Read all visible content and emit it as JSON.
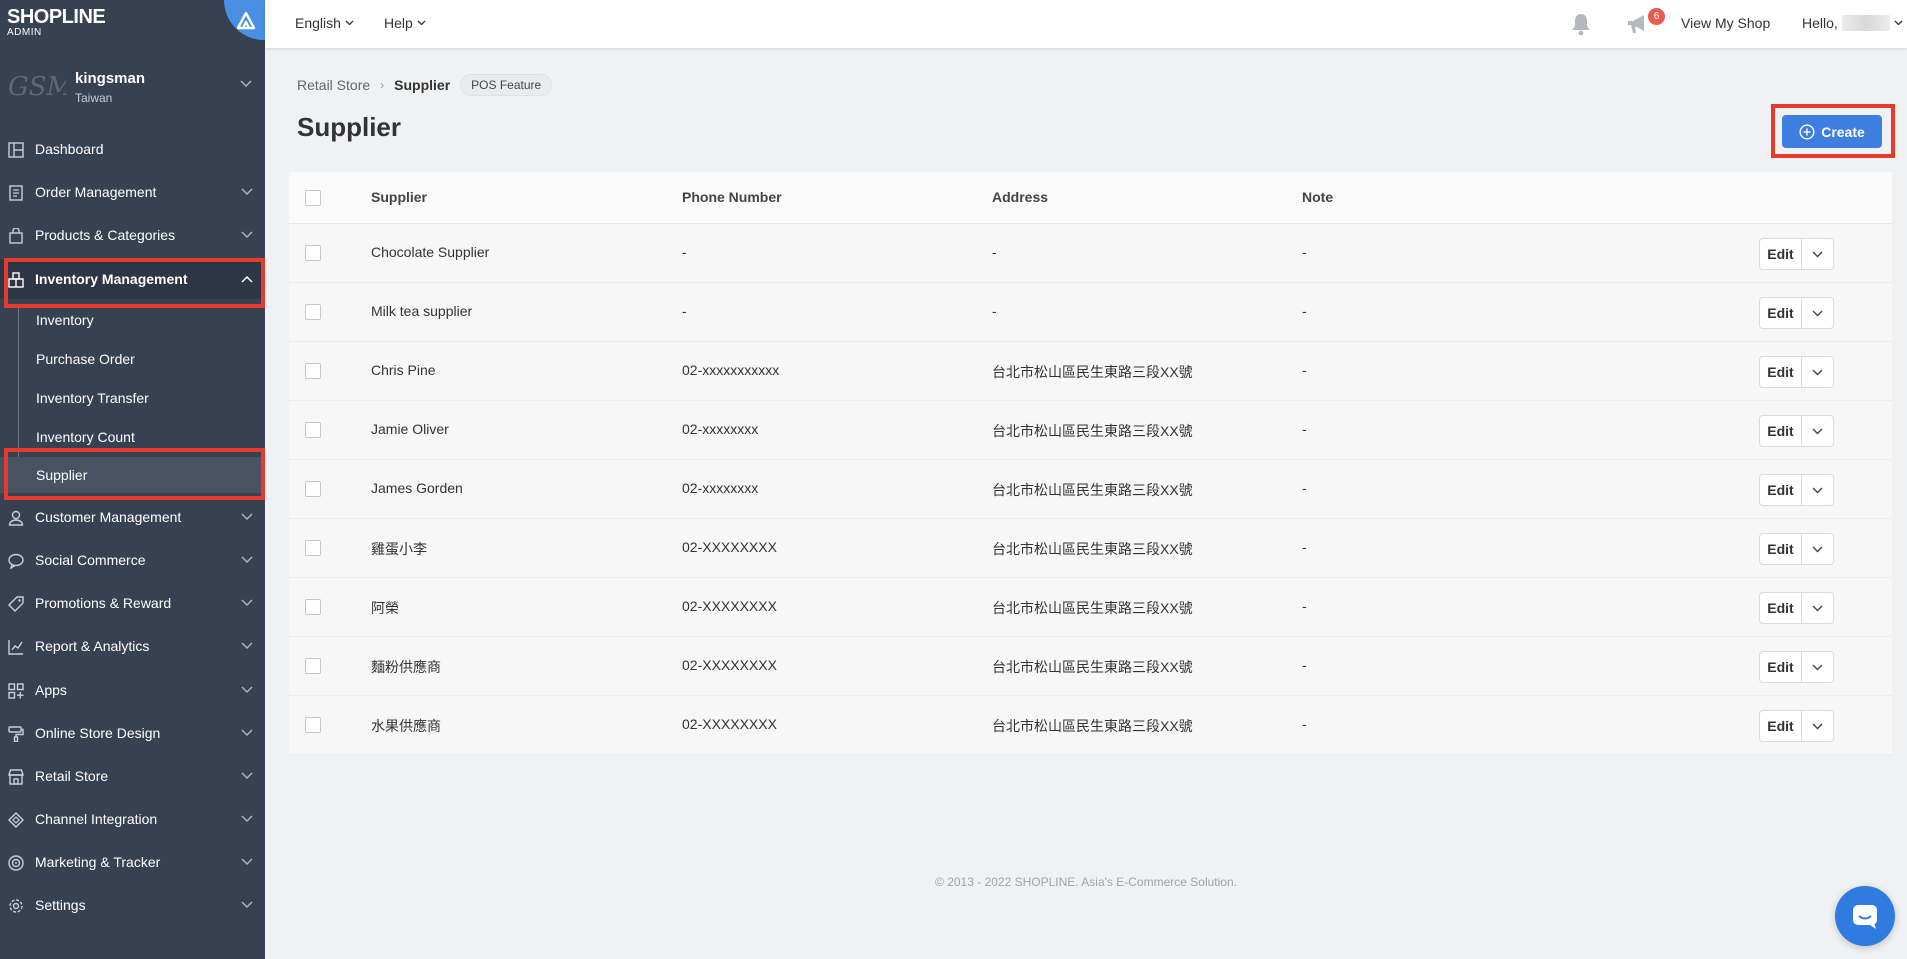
{
  "brand": {
    "logo": "SHOPLINE",
    "sub": "ADMIN",
    "accent": "#4a90e2"
  },
  "account": {
    "logo": "GSM",
    "name": "kingsman",
    "region": "Taiwan"
  },
  "sidebar": {
    "items": [
      {
        "label": "Dashboard",
        "icon": "dashboard-icon"
      },
      {
        "label": "Order Management",
        "icon": "order-icon"
      },
      {
        "label": "Products & Categories",
        "icon": "bag-icon"
      },
      {
        "label": "Inventory Management",
        "icon": "warehouse-icon"
      },
      {
        "label": "Customer Management",
        "icon": "user-icon"
      },
      {
        "label": "Social Commerce",
        "icon": "chat-icon"
      },
      {
        "label": "Promotions & Reward",
        "icon": "tag-icon"
      },
      {
        "label": "Report & Analytics",
        "icon": "chart-icon"
      },
      {
        "label": "Apps",
        "icon": "apps-icon"
      },
      {
        "label": "Online Store Design",
        "icon": "paint-icon"
      },
      {
        "label": "Retail Store",
        "icon": "store-icon"
      },
      {
        "label": "Channel Integration",
        "icon": "channel-icon"
      },
      {
        "label": "Marketing & Tracker",
        "icon": "target-icon"
      },
      {
        "label": "Settings",
        "icon": "gear-icon"
      }
    ],
    "sub_items": [
      "Inventory",
      "Purchase Order",
      "Inventory Transfer",
      "Inventory Count",
      "Supplier"
    ]
  },
  "header": {
    "language": "English",
    "help": "Help",
    "notification_count": "6",
    "view_shop": "View My Shop",
    "hello": "Hello,"
  },
  "breadcrumb": {
    "root": "Retail Store",
    "current": "Supplier",
    "tag": "POS Feature"
  },
  "page": {
    "title": "Supplier",
    "create_label": "Create"
  },
  "table": {
    "columns": [
      "Supplier",
      "Phone Number",
      "Address",
      "Note"
    ],
    "rows": [
      {
        "supplier": "Chocolate Supplier",
        "phone": "-",
        "address": "-",
        "note": "-"
      },
      {
        "supplier": "Milk tea supplier",
        "phone": "-",
        "address": "-",
        "note": "-"
      },
      {
        "supplier": "Chris Pine",
        "phone": "02-xxxxxxxxxxx",
        "address": "台北市松山區民生東路三段XX號",
        "note": "-"
      },
      {
        "supplier": "Jamie Oliver",
        "phone": "02-xxxxxxxx",
        "address": "台北市松山區民生東路三段XX號",
        "note": "-"
      },
      {
        "supplier": "James Gorden",
        "phone": "02-xxxxxxxx",
        "address": "台北市松山區民生東路三段XX號",
        "note": "-"
      },
      {
        "supplier": "雞蛋小李",
        "phone": "02-XXXXXXXX",
        "address": "台北市松山區民生東路三段XX號",
        "note": "-"
      },
      {
        "supplier": "阿榮",
        "phone": "02-XXXXXXXX",
        "address": "台北市松山區民生東路三段XX號",
        "note": "-"
      },
      {
        "supplier": "麵粉供應商",
        "phone": "02-XXXXXXXX",
        "address": "台北市松山區民生東路三段XX號",
        "note": "-"
      },
      {
        "supplier": "水果供應商",
        "phone": "02-XXXXXXXX",
        "address": "台北市松山區民生東路三段XX號",
        "note": "-"
      }
    ],
    "edit_label": "Edit"
  },
  "footer": {
    "text": "© 2013 - 2022 SHOPLINE. Asia's E-Commerce Solution."
  },
  "colors": {
    "sidebar": "#364152",
    "primary": "#3d7ee0",
    "highlight": "#e53a2c"
  }
}
